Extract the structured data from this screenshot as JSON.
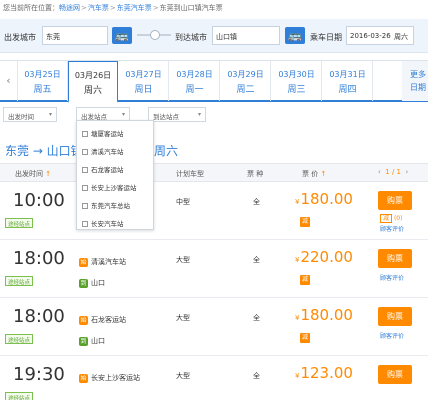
{
  "breadcrumb": {
    "prefix": "您当前所在位置：",
    "items": [
      "畅途网",
      "汽车票",
      "东莞汽车票",
      "东莞到山口镇汽车票"
    ]
  },
  "search": {
    "from_label": "出发城市",
    "from_value": "东莞",
    "to_label": "到达城市",
    "to_value": "山口镇",
    "date_label": "乘车日期",
    "date_value": "2016-03-26",
    "weekday": "周六"
  },
  "dates": [
    {
      "date": "03月25日",
      "week": "周五"
    },
    {
      "date": "03月26日",
      "week": "周六"
    },
    {
      "date": "03月27日",
      "week": "周日"
    },
    {
      "date": "03月28日",
      "week": "周一"
    },
    {
      "date": "03月29日",
      "week": "周二"
    },
    {
      "date": "03月30日",
      "week": "周三"
    },
    {
      "date": "03月31日",
      "week": "周四"
    }
  ],
  "more": {
    "line1": "更多",
    "line2": "日期"
  },
  "filters": {
    "time": "出发时间",
    "station": "出发站点",
    "arrive": "到达站点"
  },
  "station_options": [
    "塘厦客运站",
    "清溪汽车站",
    "石龙客运站",
    "长安上沙客运站",
    "东莞汽车总站",
    "长安汽车站"
  ],
  "route": {
    "text": "东莞 → 山口镇",
    "weekday": "周六"
  },
  "table_header": {
    "time": "出发时间",
    "bus": "计划车型",
    "ticket": "票 种",
    "price": "票 价",
    "pager": "1 / 1"
  },
  "rows": [
    {
      "time": "10:00",
      "badge": "途经站点",
      "start": "",
      "end": "",
      "bus": "中型",
      "ticket": "全",
      "price": "180.00",
      "coupon": "(0)",
      "review": "顾客评价"
    },
    {
      "time": "18:00",
      "badge": "途经站点",
      "start": "清溪汽车站",
      "end": "山口",
      "bus": "大型",
      "ticket": "全",
      "price": "220.00",
      "review": "顾客评价"
    },
    {
      "time": "18:00",
      "badge": "途经站点",
      "start": "石龙客运站",
      "end": "山口",
      "bus": "大型",
      "ticket": "全",
      "price": "180.00",
      "review": "顾客评价"
    },
    {
      "time": "19:30",
      "badge": "途经站点",
      "start": "长安上沙客运站",
      "end": "",
      "bus": "大型",
      "ticket": "全",
      "price": "123.00",
      "review": ""
    }
  ],
  "labels": {
    "buy": "购票",
    "start_tag": "始",
    "end_tag": "到",
    "discount": "减",
    "currency": "¥",
    "arrow_left": "‹",
    "sort_arrow": "↑",
    "pager_left": "‹",
    "pager_right": "›",
    "caret": "▾"
  },
  "colors": {
    "brand": "#2f7ed8",
    "accent": "#ff8a00",
    "green": "#5aa02c"
  }
}
